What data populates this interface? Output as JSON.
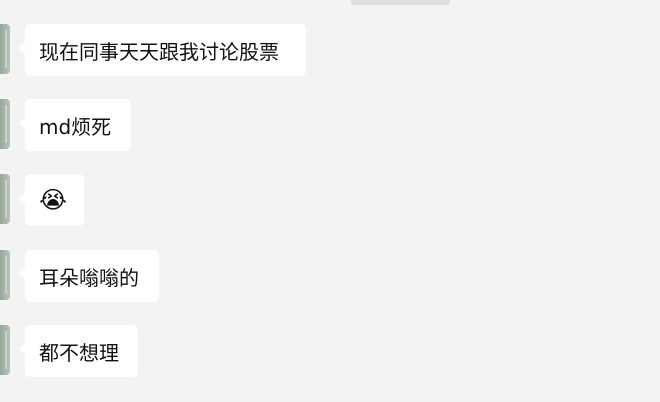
{
  "chat": {
    "messages": [
      {
        "text": "现在同事天天跟我讨论股票"
      },
      {
        "text": "md烦死"
      },
      {
        "emoji": "😭"
      },
      {
        "text": "耳朵嗡嗡的"
      },
      {
        "text": "都不想理"
      }
    ]
  }
}
